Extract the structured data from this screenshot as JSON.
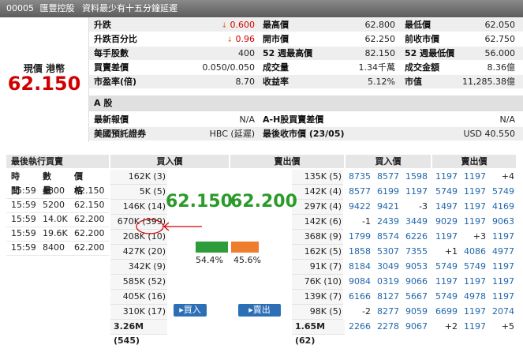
{
  "header": {
    "code": "00005",
    "name": "匯豐控股",
    "note": "資料最少有十五分鐘延遲"
  },
  "current": {
    "label": "現價 港幣",
    "price": "62.150"
  },
  "stats": {
    "change_label": "升跌",
    "change_val": "0.600",
    "pct_label": "升跌百分比",
    "pct_val": "0.96",
    "lot_label": "每手股數",
    "lot_val": "400",
    "spread_label": "買賣差價",
    "spread_val": "0.050/0.050",
    "pe_label": "市盈率(倍)",
    "pe_val": "8.70",
    "high_label": "最高價",
    "high_val": "62.800",
    "open_label": "開市價",
    "open_val": "62.250",
    "w52h_label": "52 週最高價",
    "w52h_val": "82.150",
    "vol_label": "成交量",
    "vol_val": "1.34千萬",
    "yield_label": "收益率",
    "yield_val": "5.12%",
    "low_label": "最低價",
    "low_val": "62.050",
    "prev_label": "前收市價",
    "prev_val": "62.750",
    "w52l_label": "52 週最低價",
    "w52l_val": "56.000",
    "turn_label": "成交金額",
    "turn_val": "8.36億",
    "mcap_label": "市值",
    "mcap_val": "11,285.38億"
  },
  "ashare": {
    "title": "A 股",
    "latest_label": "最新報價",
    "latest_val": "N/A",
    "ah_label": "A-H股買賣差價",
    "ah_val": "N/A",
    "adr_label": "美國預託證券",
    "adr_val": "HBC (延遲)",
    "close_label": "最後收市價 (23/05)",
    "close_val": "USD 40.550"
  },
  "trades": {
    "title": "最後執行買賣",
    "cols": [
      "時間",
      "數量",
      "價格"
    ],
    "rows": [
      [
        "15:59",
        "4800",
        "62.150"
      ],
      [
        "15:59",
        "5200",
        "62.150"
      ],
      [
        "15:59",
        "14.0K",
        "62.200"
      ],
      [
        "15:59",
        "19.6K",
        "62.200"
      ],
      [
        "15:59",
        "8400",
        "62.200"
      ]
    ]
  },
  "book": {
    "bid_title": "買入價",
    "ask_title": "賣出價",
    "bid_price": "62.150",
    "ask_price": "62.200",
    "bid_pct": "54.4%",
    "ask_pct": "45.6%",
    "bid_ratio": 0.544,
    "ask_ratio": 0.456,
    "buy_btn": "買入",
    "sell_btn": "賣出",
    "bid_queue": [
      "162K (3)",
      "5K (5)",
      "146K (14)",
      "670K (399)",
      "208K (10)",
      "427K (20)",
      "342K (9)",
      "585K (52)",
      "405K (16)",
      "310K (17)"
    ],
    "bid_total": "3.26M (545)",
    "ask_queue": [
      "135K (5)",
      "142K (4)",
      "297K (4)",
      "142K (6)",
      "368K (9)",
      "162K (5)",
      "91K (7)",
      "76K (10)",
      "139K (7)",
      "98K (5)"
    ],
    "ask_total": "1.65M (62)"
  },
  "brokers": {
    "bid_title": "買入價",
    "ask_title": "賣出價",
    "rows": [
      [
        "8735",
        "8577",
        "1598",
        "1197",
        "1197",
        "+4"
      ],
      [
        "8577",
        "6199",
        "1197",
        "5749",
        "1197",
        "5749"
      ],
      [
        "9422",
        "9421",
        "-3",
        "1497",
        "1197",
        "4169"
      ],
      [
        "-1",
        "2439",
        "3449",
        "9029",
        "1197",
        "9063"
      ],
      [
        "1799",
        "8574",
        "6226",
        "1197",
        "+3",
        "1197"
      ],
      [
        "1858",
        "5307",
        "7355",
        "+1",
        "4086",
        "4977"
      ],
      [
        "8184",
        "3049",
        "9053",
        "5749",
        "5749",
        "1197"
      ],
      [
        "9084",
        "0319",
        "9066",
        "1197",
        "1197",
        "1197"
      ],
      [
        "6166",
        "8127",
        "5667",
        "5749",
        "4978",
        "1197"
      ],
      [
        "-2",
        "8277",
        "9059",
        "6699",
        "1197",
        "2074"
      ],
      [
        "2266",
        "2278",
        "9067",
        "+2",
        "1197",
        "+5"
      ]
    ]
  },
  "colors": {
    "up": "#d10000",
    "bidbar": "#2e9c3a",
    "askbar": "#ee7d2e",
    "price_green": "#2a9a2a"
  }
}
